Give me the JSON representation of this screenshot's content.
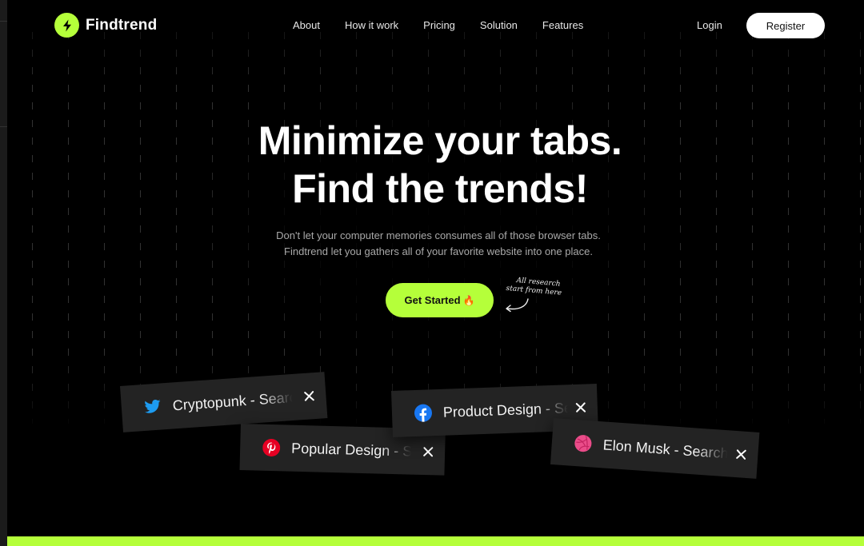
{
  "brand": {
    "name": "Findtrend",
    "accent_color": "#b5ff3a",
    "logo_icon": "lightning-bolt-icon"
  },
  "nav": {
    "items": [
      {
        "label": "About"
      },
      {
        "label": "How it work"
      },
      {
        "label": "Pricing"
      },
      {
        "label": "Solution"
      },
      {
        "label": "Features"
      }
    ],
    "login_label": "Login",
    "register_label": "Register"
  },
  "hero": {
    "title_line1": "Minimize your tabs.",
    "title_line2": "Find the trends!",
    "subtitle_line1": "Don't let your computer memories consumes all of those browser tabs.",
    "subtitle_line2": "Findtrend  let you gathers all of your favorite website into one place.",
    "cta_label": "Get Started",
    "cta_emoji": "🔥",
    "note_line1": "All research",
    "note_line2": "start from here"
  },
  "tabs": [
    {
      "title": "Cryptopunk - Search",
      "icon": "twitter-icon",
      "icon_color": "#1d9bf0"
    },
    {
      "title": "Popular Design - Search",
      "icon": "pinterest-icon",
      "icon_color": "#e60023"
    },
    {
      "title": "Product Design - Search",
      "icon": "facebook-icon",
      "icon_color": "#1877f2"
    },
    {
      "title": "Elon Musk - Search",
      "icon": "dribbble-icon",
      "icon_color": "#ea4c89"
    }
  ]
}
